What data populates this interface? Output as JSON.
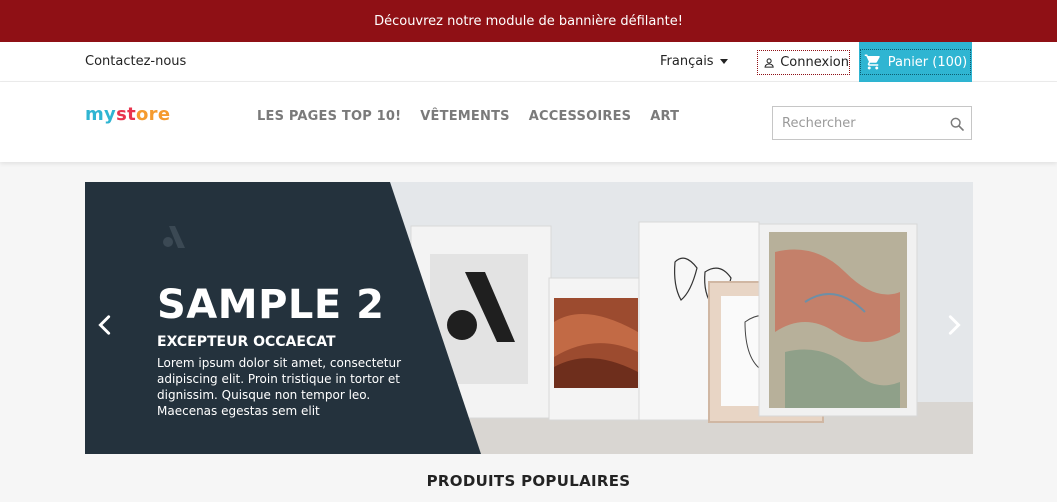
{
  "promo": {
    "text": "Découvrez notre module de bannière défilante!"
  },
  "topbar": {
    "contact_label": "Contactez-nous",
    "language_label": "Français",
    "login_label": "Connexion",
    "cart_label": "Panier (100)"
  },
  "header": {
    "logo_text_part1": "my",
    "logo_text_part2": " st",
    "logo_text_part3": "ore",
    "nav": [
      {
        "label": "LES PAGES TOP 10!"
      },
      {
        "label": "VÊTEMENTS"
      },
      {
        "label": "ACCESSOIRES"
      },
      {
        "label": "ART"
      }
    ],
    "search_placeholder": "Rechercher",
    "search_icon": "search-icon"
  },
  "carousel": {
    "title": "SAMPLE 2",
    "subtitle": "EXCEPTEUR OCCAECAT",
    "text": "Lorem ipsum dolor sit amet, consectetur adipiscing elit. Proin tristique in tortor et dignissim. Quisque non tempor leo. Maecenas egestas sem elit",
    "prev_icon": "chevron-left-icon",
    "next_icon": "chevron-right-icon"
  },
  "section": {
    "title": "PRODUITS POPULAIRES"
  },
  "colors": {
    "promo_bg": "#8f1015",
    "accent": "#2fb5d2",
    "slide_panel": "#24323d",
    "nav_text": "#7a7a7a"
  }
}
